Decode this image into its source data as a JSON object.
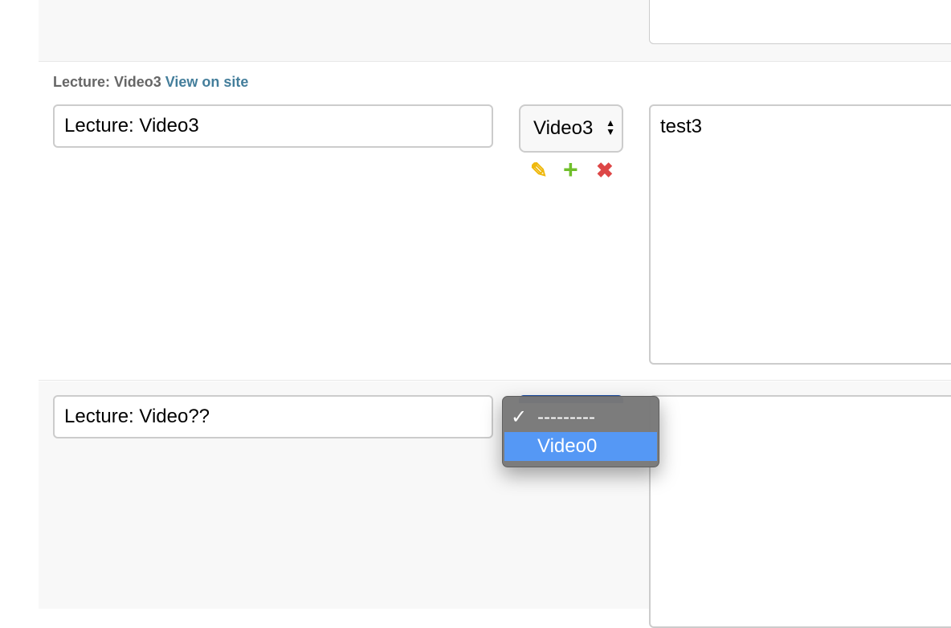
{
  "rows": {
    "video3": {
      "heading": "Lecture: Video3",
      "view_on_site": "View on site",
      "title_value": "Lecture: Video3",
      "video_select": {
        "selected": "Video3"
      },
      "actions": {
        "edit": "edit",
        "add": "add",
        "delete": "delete"
      },
      "notes_value": "test3"
    },
    "new": {
      "title_value": "Lecture: Video??",
      "dropdown": {
        "options": [
          {
            "label": "---------",
            "checked": true,
            "highlighted": false
          },
          {
            "label": "Video0",
            "checked": false,
            "highlighted": true
          }
        ]
      }
    }
  },
  "icons": {
    "edit": "pencil-icon",
    "add": "plus-icon",
    "delete": "close-icon",
    "select_arrows": "up-down-arrows-icon",
    "check": "checkmark-icon"
  },
  "colors": {
    "link": "#447e9b",
    "edit_icon": "#efb80b",
    "add_icon": "#70bf2b",
    "delete_icon": "#dd4646",
    "dropdown_highlight": "#5598f5",
    "dropdown_bg": "#787878"
  }
}
